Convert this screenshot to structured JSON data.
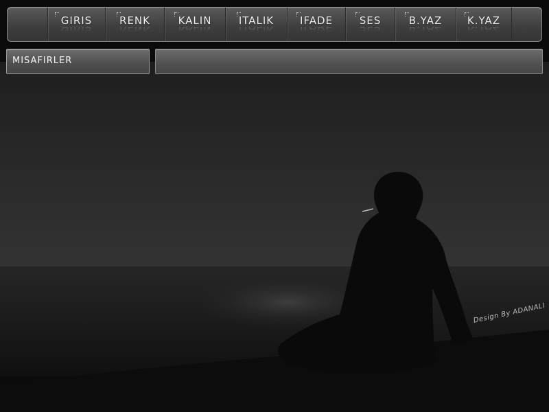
{
  "toolbar": {
    "buttons": [
      {
        "label": "GIRIS"
      },
      {
        "label": "RENK"
      },
      {
        "label": "KALIN"
      },
      {
        "label": "ITALIK"
      },
      {
        "label": "IFADE"
      },
      {
        "label": "SES"
      },
      {
        "label": "B.YAZ"
      },
      {
        "label": "K.YAZ"
      }
    ]
  },
  "guests_panel": {
    "title": "MISAFIRLER"
  },
  "credit": "Design By ADANALI",
  "colors": {
    "sky": "#2c2c2c",
    "sea": "#1e1e1e",
    "silhouette": "#0a0a0a",
    "toolbar": "#4a4a4a",
    "text": "#f2f2f2"
  }
}
